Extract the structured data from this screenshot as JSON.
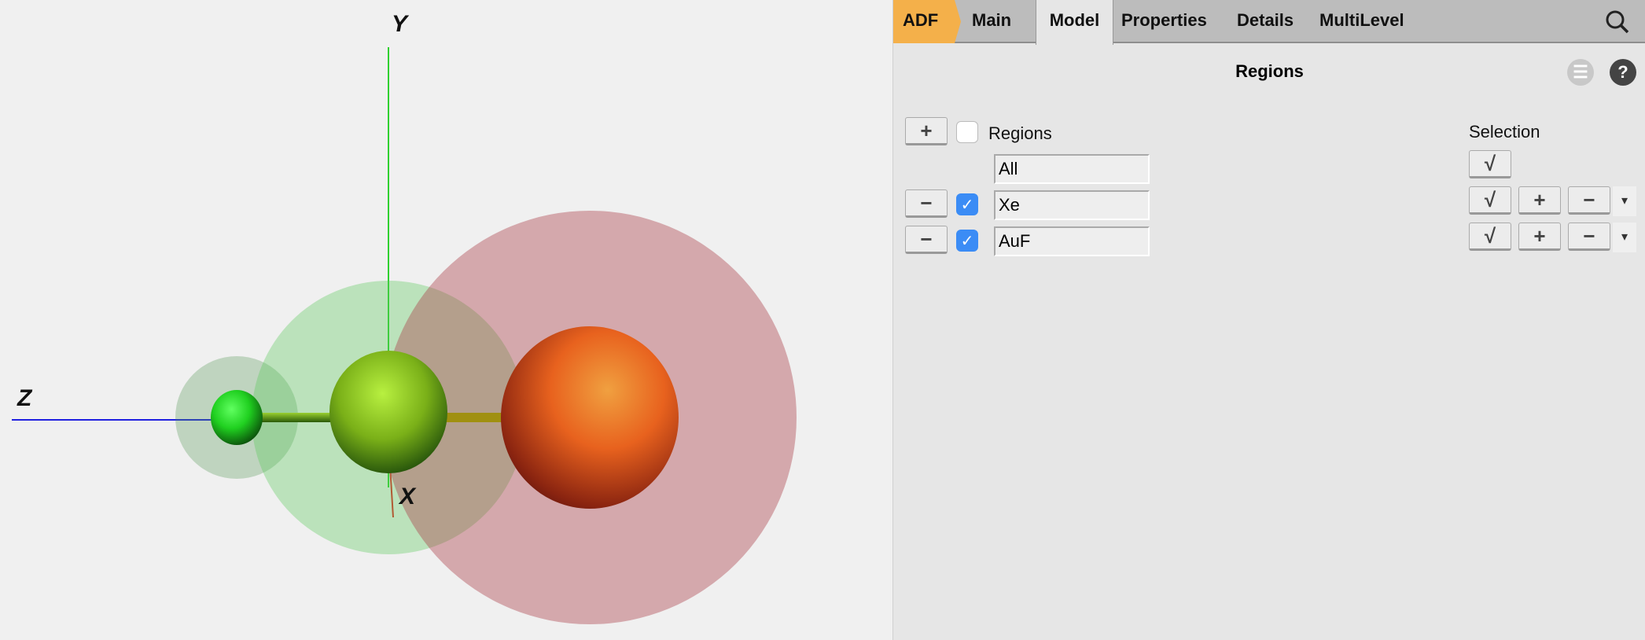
{
  "viewer": {
    "axes": {
      "x": "X",
      "y": "Y",
      "z": "Z"
    },
    "colors": {
      "x_axis": "#e02020",
      "y_axis": "#30d030",
      "z_axis": "#2020e0",
      "fluorine": "#30e030",
      "xenon": "#9adf20",
      "gold": "#e8621e"
    }
  },
  "tabs": [
    {
      "label": "ADF"
    },
    {
      "label": "Main"
    },
    {
      "label": "Model",
      "active": true
    },
    {
      "label": "Properties"
    },
    {
      "label": "Details"
    },
    {
      "label": "MultiLevel"
    }
  ],
  "panel": {
    "title": "Regions",
    "regions_header": "Regions",
    "selection_header": "Selection",
    "rows": [
      {
        "name": "All",
        "checked": null
      },
      {
        "name": "Xe",
        "checked": true
      },
      {
        "name": "AuF",
        "checked": true
      }
    ],
    "icons": {
      "add": "+",
      "remove": "−",
      "check": "√",
      "plus": "+",
      "minus": "−",
      "dropdown": "▾",
      "menu": "☰",
      "help": "?",
      "checkmark": "✓"
    }
  }
}
